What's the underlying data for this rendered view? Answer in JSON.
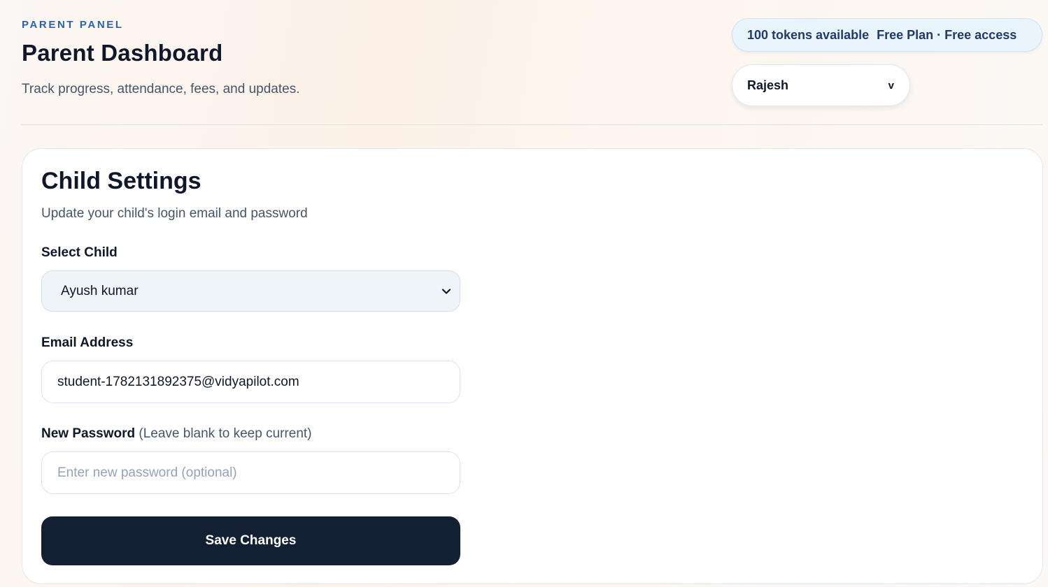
{
  "header": {
    "kicker": "PARENT PANEL",
    "title": "Parent Dashboard",
    "subtitle": "Track progress, attendance, fees, and updates.",
    "tokens": "100 tokens available",
    "plan": "Free Plan · Free access",
    "user_select": {
      "value": "Rajesh",
      "chevron": "v"
    }
  },
  "card": {
    "title": "Child Settings",
    "subtitle": "Update your child's login email and password",
    "select_child": {
      "label": "Select Child",
      "value": "Ayush kumar",
      "icon": "chevron-down-icon"
    },
    "email": {
      "label": "Email Address",
      "value": "student-1782131892375@vidyapilot.com"
    },
    "password": {
      "label": "New Password",
      "hint": "(Leave blank to keep current)",
      "placeholder": "Enter new password (optional)"
    },
    "save_label": "Save Changes"
  },
  "colors": {
    "accent": "#2563b5",
    "button_bg": "#131f33",
    "token_pill_bg": "#eaf4fc",
    "token_pill_text": "#1e3a6e"
  }
}
